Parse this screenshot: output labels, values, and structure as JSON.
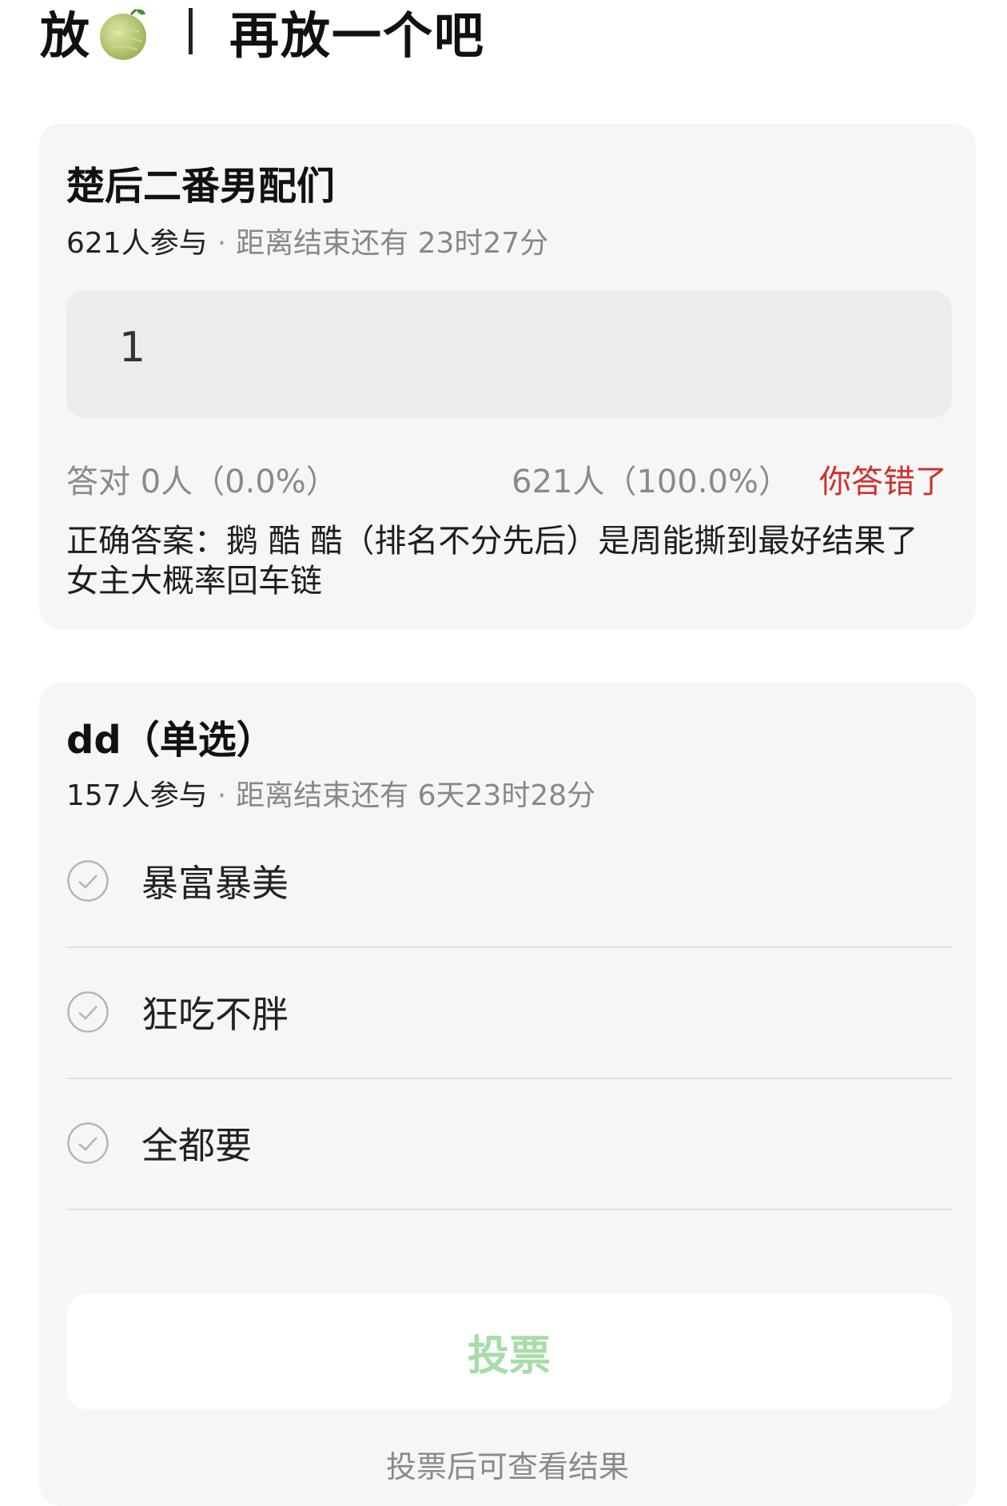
{
  "header": {
    "part1": "放",
    "emoji": "melon-icon",
    "part2": "再放一个吧"
  },
  "poll1": {
    "title": "楚后二番男配们",
    "participants": "621人参与",
    "remaining": "距离结束还有 23时27分",
    "answer_input": "1",
    "correct_stat": "答对  0人（0.0%）",
    "wrong_stat": "621人（100.0%）",
    "result": "你答错了",
    "explanation": "正确答案：鹅 酷 酷（排名不分先后）是周能撕到最好结果了 女主大概率回车链"
  },
  "poll2": {
    "title": "dd（单选）",
    "participants": "157人参与",
    "remaining": "距离结束还有 6天23时28分",
    "options": [
      {
        "label": "暴富暴美"
      },
      {
        "label": "狂吃不胖"
      },
      {
        "label": "全都要"
      }
    ],
    "vote_button": "投票",
    "footer_note": "投票后可查看结果"
  },
  "colors": {
    "card_bg": "#f6f6f6",
    "wrong_red": "#d0302b",
    "vote_green": "#a8dca8",
    "muted_text": "#8a8a8a"
  }
}
